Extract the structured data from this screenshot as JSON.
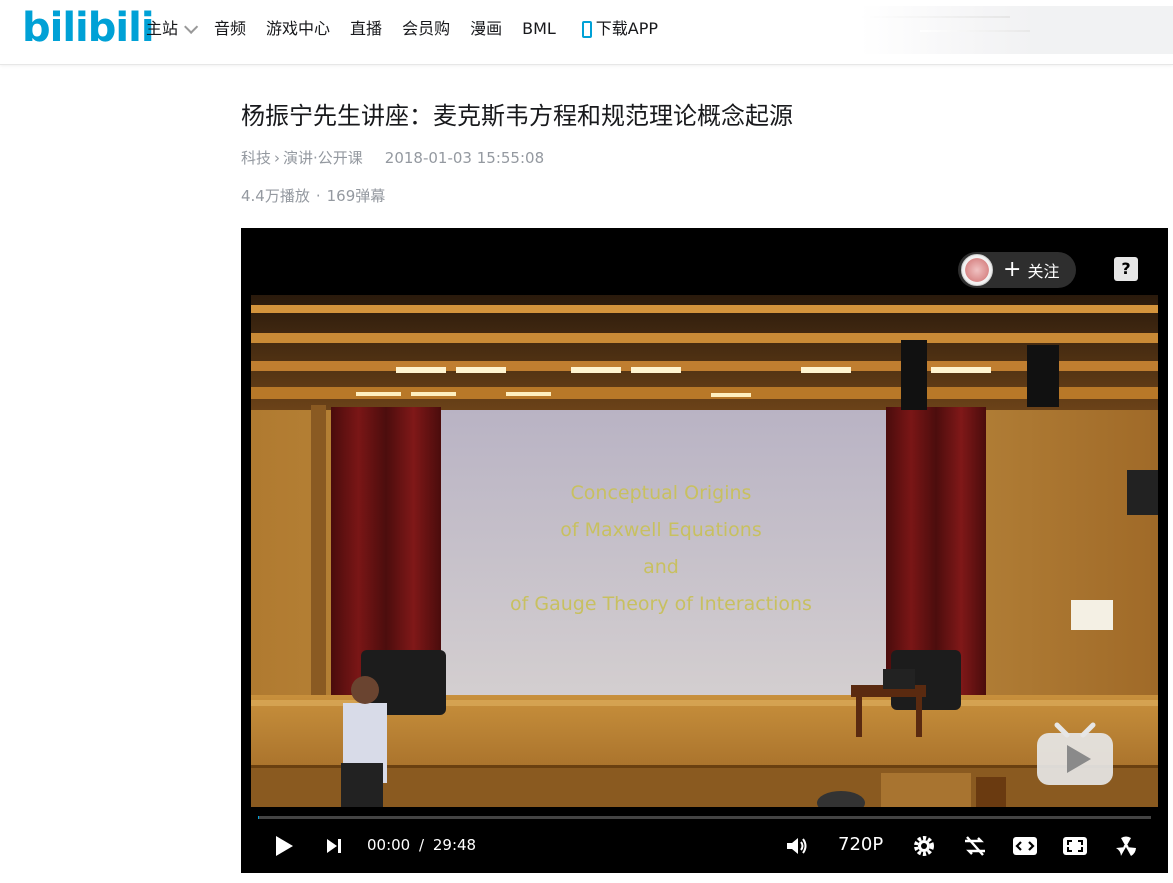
{
  "header": {
    "logo": "bilibili",
    "nav": [
      {
        "label": "主站",
        "dropdown": true
      },
      {
        "label": "音频"
      },
      {
        "label": "游戏中心"
      },
      {
        "label": "直播"
      },
      {
        "label": "会员购"
      },
      {
        "label": "漫画"
      },
      {
        "label": "BML"
      },
      {
        "label": "下载APP",
        "icon": "phone-icon"
      }
    ]
  },
  "video": {
    "title": "杨振宁先生讲座：麦克斯韦方程和规范理论概念起源",
    "category": "科技",
    "subcategory": "演讲·公开课",
    "datetime": "2018-01-03 15:55:08",
    "plays": "4.4万播放",
    "danmaku": "169弹幕",
    "slide_lines": [
      "Conceptual Origins",
      "of Maxwell Equations",
      "and",
      "of Gauge Theory of Interactions"
    ]
  },
  "player": {
    "follow_label": "关注",
    "follow_plus": "+",
    "help": "?",
    "current_time": "00:00",
    "time_sep": "/",
    "duration": "29:48",
    "quality": "720P",
    "progress_fraction": 0.001
  },
  "colors": {
    "brand": "#00a1d6",
    "slide_text": "#c8c060"
  }
}
